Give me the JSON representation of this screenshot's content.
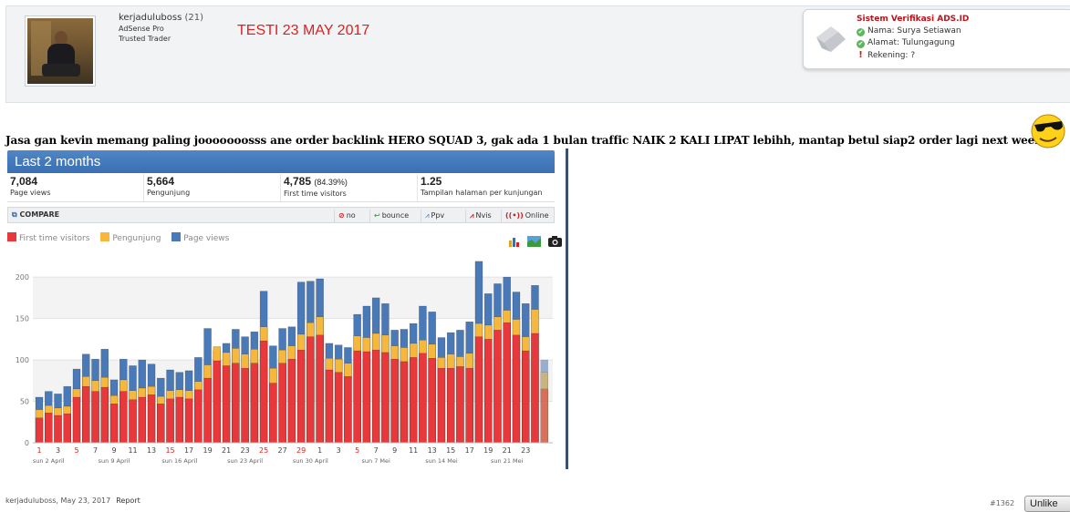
{
  "user": {
    "username": "kerjaduluboss",
    "count": "(21)",
    "titles": [
      "AdSense Pro",
      "Trusted Trader"
    ],
    "testi_label": "TESTI 23 MAY 2017"
  },
  "verification": {
    "title": "Sistem Verifikasi ADS.ID",
    "rows": [
      {
        "label": "Nama: Surya Setiawan",
        "status": "check"
      },
      {
        "label": "Alamat: Tulungagung",
        "status": "check"
      },
      {
        "label": "Rekening: ?",
        "status": "warning"
      }
    ]
  },
  "post": {
    "text": "Jasa gan kevin memang paling jooooooosss ane order backlink HERO SQUAD 3, gak ada 1 bulan traffic NAIK 2 KALI LIPAT lebihh, mantap betul siap2 order lagi next week"
  },
  "analytics": {
    "header": "Last 2 months",
    "stats": [
      {
        "value": "7,084",
        "extra": "",
        "label": "Page views"
      },
      {
        "value": "5,664",
        "extra": "",
        "label": "Pengunjung"
      },
      {
        "value": "4,785",
        "extra": "(84.39%)",
        "label": "First time visitors"
      },
      {
        "value": "1.25",
        "extra": "",
        "label": "Tampilan halaman per kunjungan"
      }
    ],
    "toolbar": {
      "compare": "COMPARE",
      "buttons": [
        "no",
        "bounce",
        "Ppv",
        "Nvis",
        "Online"
      ]
    }
  },
  "chart_data": {
    "type": "bar",
    "stacked": true,
    "ylim": [
      0,
      220
    ],
    "yticks": [
      0,
      50,
      100,
      150,
      200
    ],
    "x_day_labels": [
      "1",
      "3",
      "5",
      "7",
      "9",
      "11",
      "13",
      "15",
      "17",
      "19",
      "21",
      "23",
      "25",
      "27",
      "29",
      "1",
      "3",
      "5",
      "7",
      "9",
      "11",
      "13",
      "15",
      "17",
      "19",
      "21",
      "23"
    ],
    "x_week_labels": [
      "sun 2 April",
      "sun 9 April",
      "sun 16 April",
      "sun 23 April",
      "sun 30 April",
      "sun 7 Mei",
      "sun 14 Mei",
      "sun 21 Mei"
    ],
    "colors": {
      "first": "#e8383b",
      "visitors": "#f5b83d",
      "pageviews": "#4a79b8"
    },
    "series": [
      {
        "name": "First time visitors",
        "values": [
          30,
          36,
          33,
          35,
          55,
          68,
          62,
          67,
          47,
          62,
          52,
          55,
          58,
          47,
          53,
          55,
          53,
          64,
          78,
          99,
          93,
          96,
          90,
          96,
          123,
          72,
          96,
          101,
          112,
          128,
          130,
          88,
          85,
          80,
          111,
          110,
          112,
          109,
          101,
          98,
          103,
          108,
          102,
          90,
          90,
          92,
          90,
          128,
          125,
          136,
          145,
          130,
          111,
          132,
          65
        ]
      },
      {
        "name": "Pengunjung",
        "values": [
          40,
          45,
          42,
          44,
          65,
          80,
          75,
          79,
          57,
          76,
          63,
          66,
          68,
          56,
          63,
          64,
          63,
          74,
          94,
          116,
          109,
          114,
          107,
          113,
          140,
          90,
          112,
          117,
          131,
          145,
          152,
          102,
          101,
          96,
          129,
          127,
          132,
          130,
          117,
          115,
          120,
          124,
          119,
          103,
          107,
          104,
          108,
          144,
          142,
          152,
          160,
          149,
          128,
          161,
          85
        ]
      },
      {
        "name": "Page views",
        "values": [
          55,
          62,
          59,
          68,
          89,
          107,
          101,
          113,
          76,
          101,
          93,
          100,
          95,
          78,
          88,
          85,
          87,
          103,
          138,
          111,
          120,
          137,
          128,
          134,
          183,
          117,
          138,
          140,
          194,
          195,
          198,
          120,
          118,
          115,
          155,
          165,
          175,
          168,
          136,
          137,
          144,
          165,
          158,
          127,
          133,
          136,
          146,
          219,
          180,
          192,
          200,
          182,
          168,
          190,
          100
        ]
      }
    ]
  },
  "chart_ui": {
    "legend": [
      "First time visitors",
      "Pengunjung",
      "Page views"
    ]
  },
  "footer": {
    "meta": "kerjaduluboss, May 23, 2017",
    "report": "Report",
    "post_number": "#1362",
    "unlike": "Unlike"
  }
}
